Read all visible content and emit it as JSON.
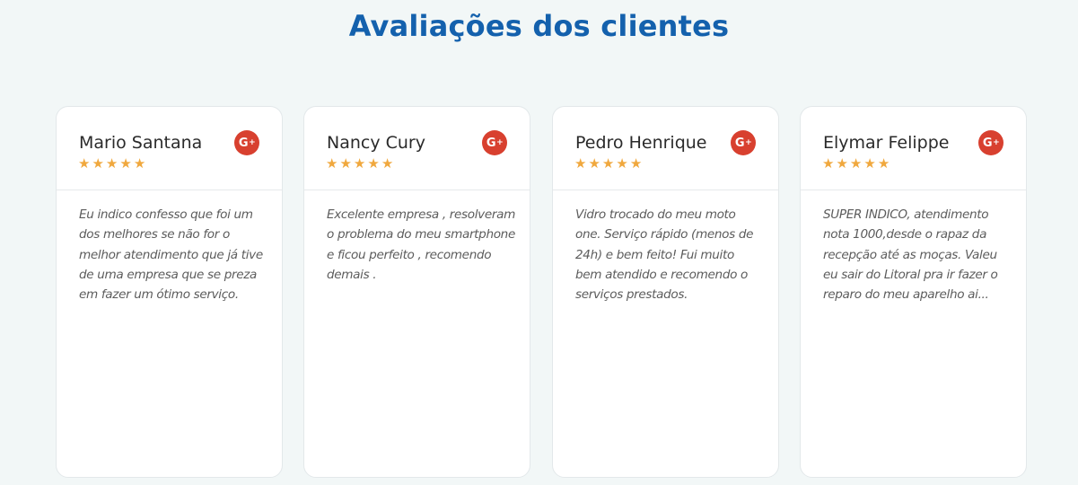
{
  "section": {
    "title": "Avaliações dos clientes"
  },
  "colors": {
    "title": "#1461ad",
    "star": "#f0a83e",
    "gplus": "#d8402f",
    "background": "#f2f7f7"
  },
  "icons": {
    "review_source": "google-plus-icon",
    "rating": "star-icon"
  },
  "reviews": [
    {
      "name": "Mario Santana",
      "rating": 5,
      "text": "Eu indico confesso que foi um dos melhores se não for o melhor atendimento que já tive de uma empresa que se preza em fazer um ótimo serviço."
    },
    {
      "name": "Nancy Cury",
      "rating": 5,
      "text": "Excelente empresa , resolveram o problema do meu smartphone e ficou perfeito , recomendo demais ."
    },
    {
      "name": "Pedro Henrique",
      "rating": 5,
      "text": "Vidro trocado do meu moto one. Serviço rápido (menos de 24h) e bem feito! Fui muito bem atendido e recomendo o serviços prestados."
    },
    {
      "name": "Elymar Felippe",
      "rating": 5,
      "text": "SUPER INDICO, atendimento nota 1000,desde o rapaz da recepção até as moças. Valeu eu sair do Litoral pra ir fazer o reparo do meu aparelho ai..."
    }
  ]
}
